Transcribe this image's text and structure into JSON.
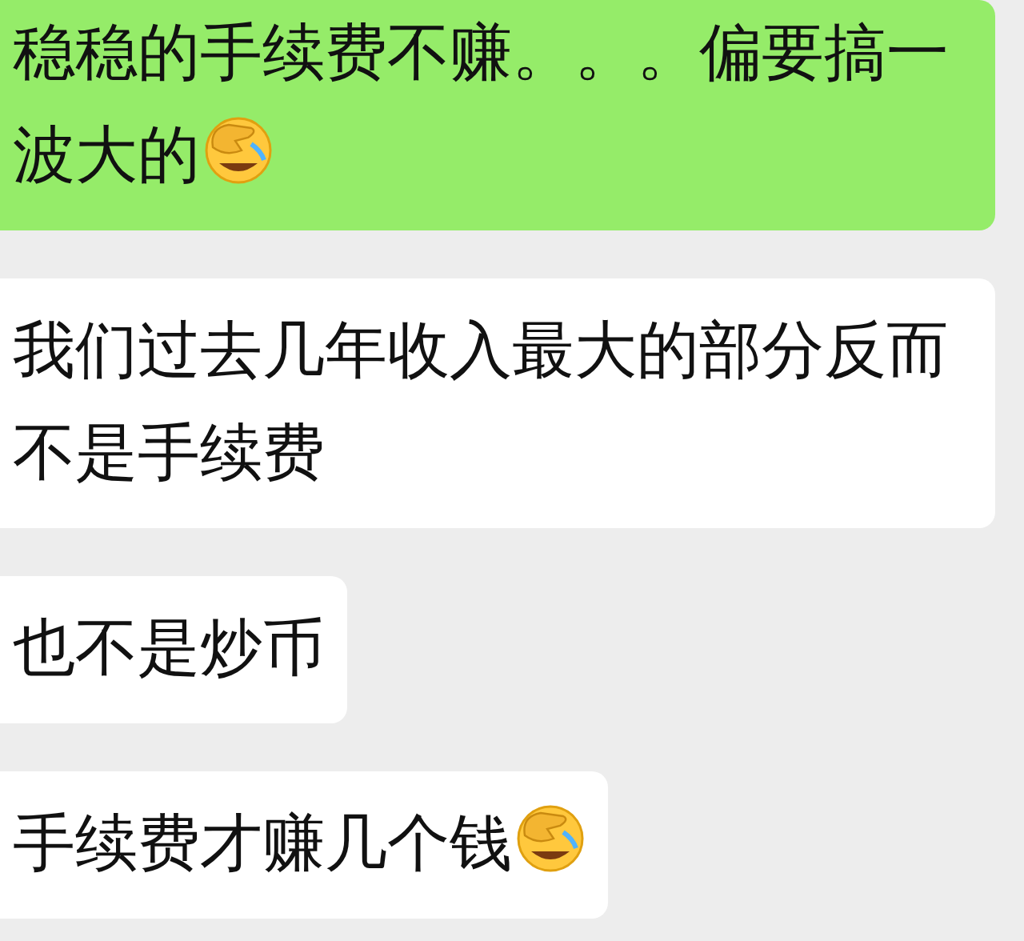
{
  "messages": [
    {
      "outgoing": true,
      "text": "稳稳的手续费不赚。。。偏要搞一波大的",
      "emoji": true
    },
    {
      "outgoing": false,
      "text": "我们过去几年收入最大的部分反而不是手续费",
      "emoji": false
    },
    {
      "outgoing": false,
      "text": "也不是炒币",
      "emoji": false
    },
    {
      "outgoing": false,
      "text": "手续费才赚几个钱",
      "emoji": true
    }
  ]
}
